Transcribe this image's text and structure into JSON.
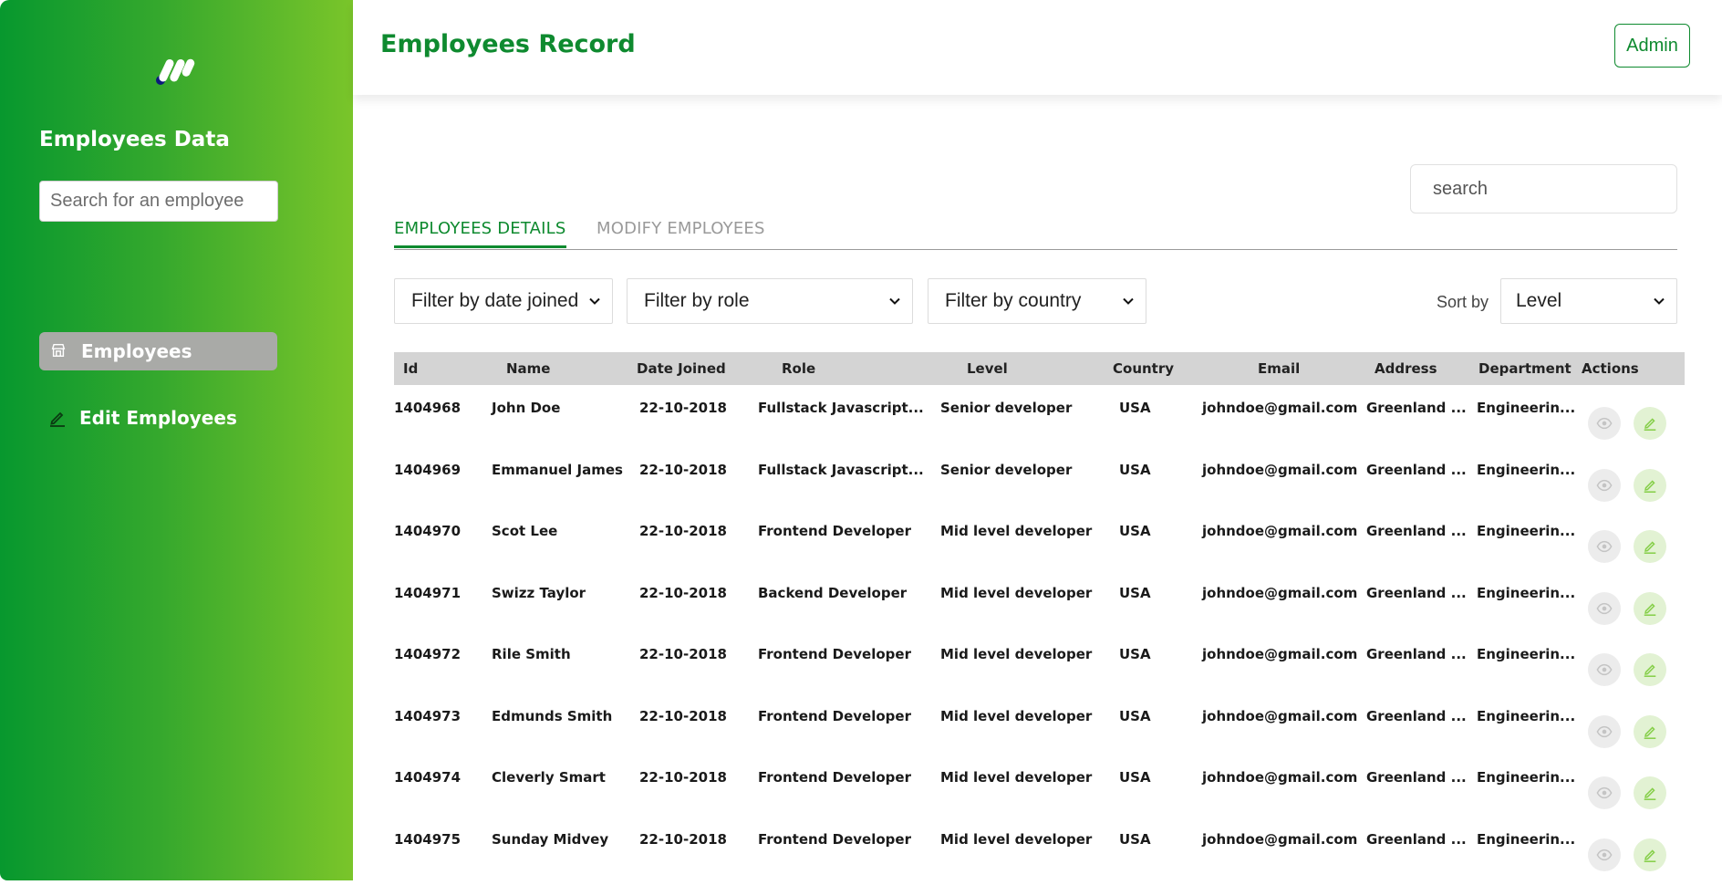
{
  "sidebar": {
    "title": "Employees Data",
    "search_placeholder": "Search for an employee",
    "items": [
      {
        "label": "Employees",
        "icon": "store-icon",
        "active": true
      },
      {
        "label": "Edit Employees",
        "icon": "pencil-icon",
        "active": false
      }
    ]
  },
  "header": {
    "title": "Employees Record",
    "admin_label": "Admin"
  },
  "main": {
    "search_placeholder": "search",
    "tabs": [
      {
        "label": "EMPLOYEES DETAILS",
        "active": true
      },
      {
        "label": "MODIFY EMPLOYEES",
        "active": false
      }
    ],
    "filters": {
      "date": "Filter by date joined",
      "role": "Filter by role",
      "country": "Filter by country"
    },
    "sort": {
      "label": "Sort by",
      "value": "Level"
    }
  },
  "table": {
    "headers": [
      "Id",
      "Name",
      "Date Joined",
      "Role",
      "Level",
      "Country",
      "Email",
      "Address",
      "Department",
      "Actions"
    ],
    "rows": [
      {
        "id": "1404968",
        "name": "John Doe",
        "date": "22-10-2018",
        "role": "Fullstack Javascript...",
        "level": "Senior developer",
        "country": "USA",
        "email": "johndoe@gmail.com",
        "address": "Greenland ...",
        "department": "Engineerin..."
      },
      {
        "id": "1404969",
        "name": "Emmanuel James",
        "date": "22-10-2018",
        "role": "Fullstack Javascript...",
        "level": "Senior developer",
        "country": "USA",
        "email": "johndoe@gmail.com",
        "address": "Greenland ...",
        "department": "Engineerin..."
      },
      {
        "id": "1404970",
        "name": "Scot Lee",
        "date": "22-10-2018",
        "role": "Frontend Developer",
        "level": "Mid level developer",
        "country": "USA",
        "email": "johndoe@gmail.com",
        "address": "Greenland ...",
        "department": "Engineerin..."
      },
      {
        "id": "1404971",
        "name": "Swizz Taylor",
        "date": "22-10-2018",
        "role": "Backend Developer",
        "level": "Mid level developer",
        "country": "USA",
        "email": "johndoe@gmail.com",
        "address": "Greenland ...",
        "department": "Engineerin..."
      },
      {
        "id": "1404972",
        "name": "Rile Smith",
        "date": "22-10-2018",
        "role": "Frontend Developer",
        "level": "Mid level developer",
        "country": "USA",
        "email": "johndoe@gmail.com",
        "address": "Greenland ...",
        "department": "Engineerin..."
      },
      {
        "id": "1404973",
        "name": "Edmunds Smith",
        "date": "22-10-2018",
        "role": "Frontend Developer",
        "level": "Mid level developer",
        "country": "USA",
        "email": "johndoe@gmail.com",
        "address": "Greenland ...",
        "department": "Engineerin..."
      },
      {
        "id": "1404974",
        "name": "Cleverly Smart",
        "date": "22-10-2018",
        "role": "Frontend Developer",
        "level": "Mid level developer",
        "country": "USA",
        "email": "johndoe@gmail.com",
        "address": "Greenland ...",
        "department": "Engineerin..."
      },
      {
        "id": "1404975",
        "name": "Sunday Midvey",
        "date": "22-10-2018",
        "role": "Frontend Developer",
        "level": "Mid level developer",
        "country": "USA",
        "email": "johndoe@gmail.com",
        "address": "Greenland ...",
        "department": "Engineerin..."
      }
    ],
    "action_icons": [
      "eye-icon",
      "pencil-icon"
    ]
  },
  "colors": {
    "brand": "#0e8a2f",
    "sidebar_start": "#07982e",
    "sidebar_end": "#7ac52a",
    "table_header": "#d4d4d4"
  }
}
